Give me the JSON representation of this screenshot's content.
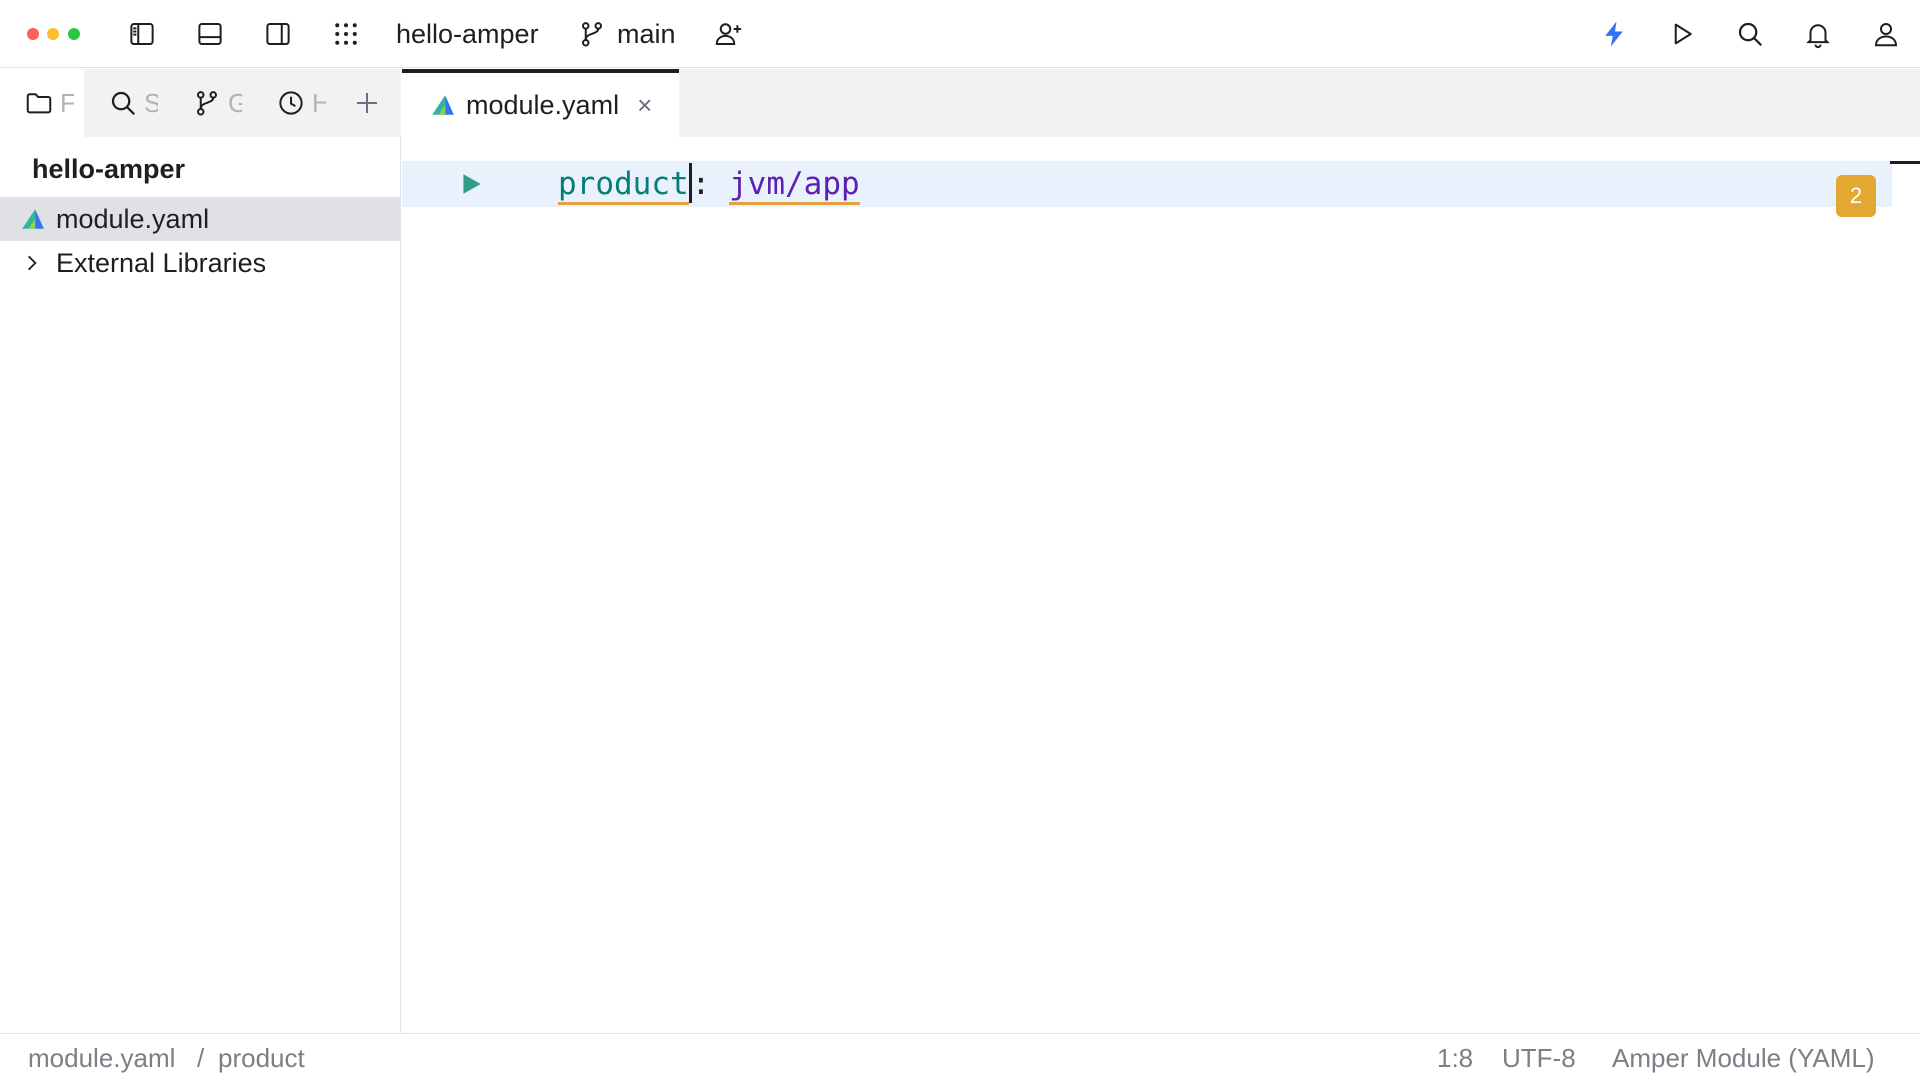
{
  "window": {
    "traffic_colors": [
      "#ff5f57",
      "#febc2e",
      "#28c840"
    ]
  },
  "titlebar": {
    "project_name": "hello-amper",
    "branch_name": "main",
    "left_icons": [
      "left-sidebar-toggle-icon",
      "bottom-panel-toggle-icon",
      "right-sidebar-toggle-icon",
      "apps-grid-icon"
    ],
    "right_icons": [
      "lightning-icon",
      "run-icon",
      "search-icon",
      "bell-icon",
      "profile-icon"
    ],
    "accent_color": "#3574f0"
  },
  "sidebar": {
    "tabs": [
      {
        "icon": "folder-icon",
        "label": "Files"
      },
      {
        "icon": "search-icon",
        "label": "Search"
      },
      {
        "icon": "git-branch-icon",
        "label": "Git"
      },
      {
        "icon": "history-icon",
        "label": "History"
      }
    ],
    "add_icon": "plus-icon",
    "tree_root": "hello-amper",
    "tree_items": [
      {
        "label": "module.yaml",
        "icon": "amper-file-icon",
        "selected": true
      },
      {
        "label": "External Libraries",
        "icon": "chevron-right-icon",
        "selected": false
      }
    ]
  },
  "editor": {
    "tab_label": "module.yaml",
    "tab_close": "×",
    "code_key": "product",
    "code_colon": ":",
    "code_value": "jvm/app",
    "problems_count": "2"
  },
  "statusbar": {
    "breadcrumb_file": "module.yaml",
    "breadcrumb_sep": "/",
    "breadcrumb_item": "product",
    "cursor_position": "1:8",
    "encoding": "UTF-8",
    "file_type": "Amper Module (YAML)"
  }
}
